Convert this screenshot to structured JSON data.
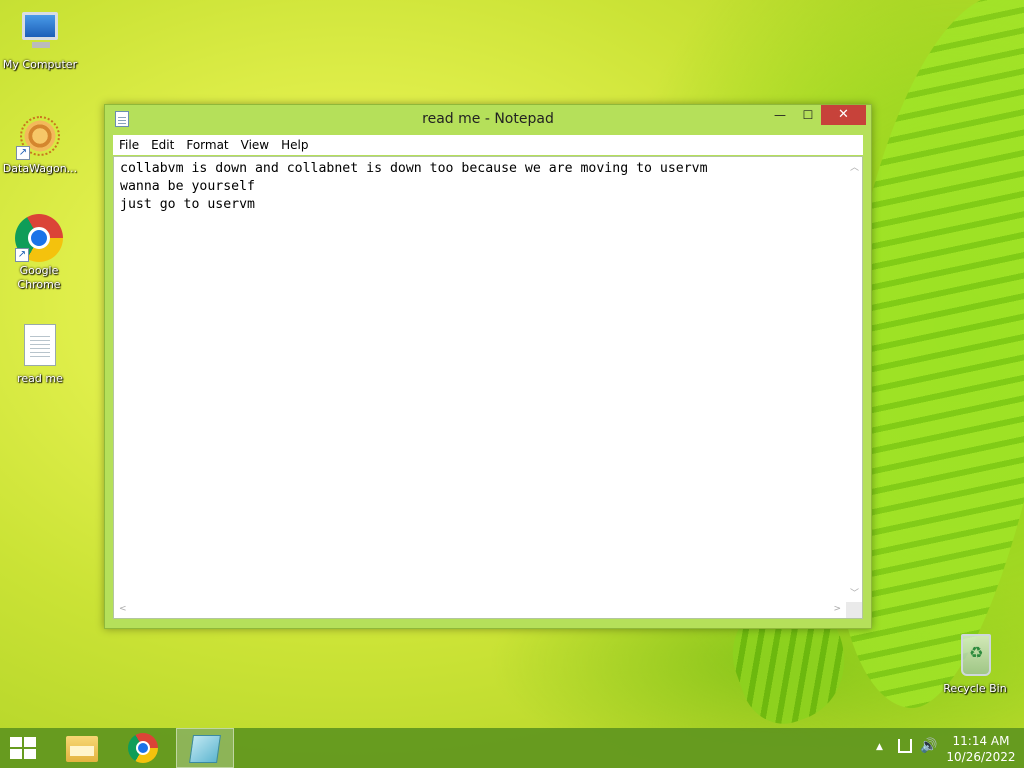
{
  "desktop": {
    "icons": [
      {
        "label": "My Computer",
        "icon": "computer-icon"
      },
      {
        "label": "DataWagon...",
        "icon": "datawagon-icon"
      },
      {
        "label": "Google Chrome",
        "icon": "chrome-icon"
      },
      {
        "label": "read me",
        "icon": "text-file-icon"
      },
      {
        "label": "Recycle Bin",
        "icon": "recycle-bin-icon"
      }
    ]
  },
  "notepad": {
    "title": "read me - Notepad",
    "window_buttons": {
      "minimize": "—",
      "maximize": "☐",
      "close": "✕"
    },
    "menu": [
      "File",
      "Edit",
      "Format",
      "View",
      "Help"
    ],
    "content": "collabvm is down and collabnet is down too because we are moving to uservm\nwanna be yourself\njust go to uservm"
  },
  "taskbar": {
    "start_icon": "windows-logo-icon",
    "pinned": [
      {
        "icon": "file-explorer-icon"
      },
      {
        "icon": "chrome-icon"
      },
      {
        "icon": "notepad-icon",
        "active": true
      }
    ],
    "tray": {
      "show_hidden": "▲",
      "network_icon": "network-icon",
      "volume": "🔊",
      "time": "11:14 AM",
      "date": "10/26/2022"
    }
  },
  "colors": {
    "accent": "#b5e05a",
    "close_button": "#c7423a",
    "taskbar": "#5f961e"
  }
}
